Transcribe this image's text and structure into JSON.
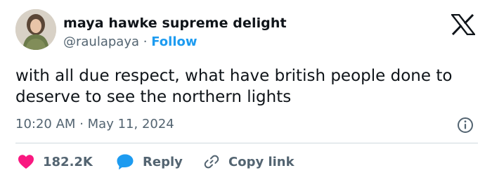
{
  "author": {
    "display_name": "maya hawke supreme delight",
    "handle": "@raulapaya",
    "separator": "·",
    "follow_label": "Follow"
  },
  "brand_logo": "x-logo-icon",
  "tweet": {
    "text": "with all due respect, what have british people done to deserve to see the northern lights",
    "time": "10:20 AM",
    "date_separator": "·",
    "date": "May 11, 2024"
  },
  "actions": {
    "likes_count": "182.2K",
    "reply_label": "Reply",
    "copy_link_label": "Copy link"
  },
  "icons": {
    "like": "heart-icon",
    "reply": "speech-bubble-icon",
    "copy": "link-icon",
    "info": "info-icon"
  },
  "colors": {
    "text": "#0f1419",
    "secondary": "#536471",
    "link": "#1d9bf0",
    "heart": "#f91880",
    "divider": "#cfd9de"
  }
}
